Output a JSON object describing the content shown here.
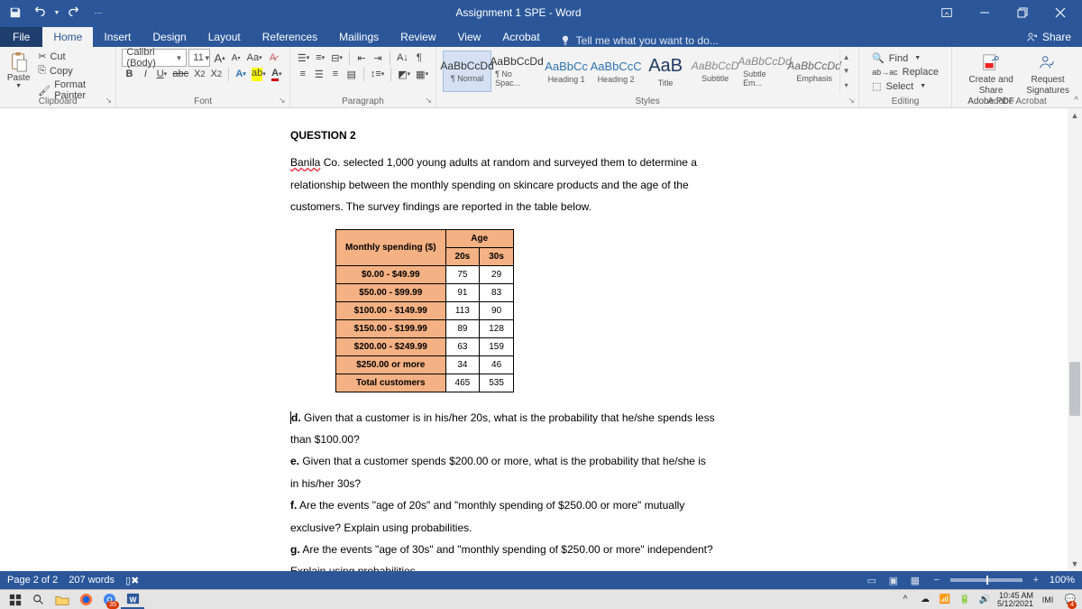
{
  "titlebar": {
    "title": "Assignment 1 SPE - Word"
  },
  "tabs": {
    "file": "File",
    "home": "Home",
    "insert": "Insert",
    "design": "Design",
    "layout": "Layout",
    "references": "References",
    "mailings": "Mailings",
    "review": "Review",
    "view": "View",
    "acrobat": "Acrobat",
    "tellme": "Tell me what you want to do...",
    "share": "Share"
  },
  "ribbon": {
    "clipboard": {
      "label": "Clipboard",
      "paste": "Paste",
      "cut": "Cut",
      "copy": "Copy",
      "painter": "Format Painter"
    },
    "font": {
      "label": "Font",
      "name": "Calibri (Body)",
      "size": "11"
    },
    "paragraph": {
      "label": "Paragraph"
    },
    "styles": {
      "label": "Styles",
      "items": [
        {
          "sample": "AaBbCcDd",
          "name": "¶ Normal",
          "cls": ""
        },
        {
          "sample": "AaBbCcDd",
          "name": "¶ No Spac...",
          "cls": ""
        },
        {
          "sample": "AaBbCc",
          "name": "Heading 1",
          "cls": "med"
        },
        {
          "sample": "AaBbCcC",
          "name": "Heading 2",
          "cls": "med"
        },
        {
          "sample": "AaB",
          "name": "Title",
          "cls": "bigger"
        },
        {
          "sample": "AaBbCcD",
          "name": "Subtitle",
          "cls": "subtle"
        },
        {
          "sample": "AaBbCcDd",
          "name": "Subtle Em...",
          "cls": "subtle"
        },
        {
          "sample": "AaBbCcDd",
          "name": "Emphasis",
          "cls": "emph"
        }
      ]
    },
    "editing": {
      "label": "Editing",
      "find": "Find",
      "replace": "Replace",
      "select": "Select"
    },
    "adobe": {
      "label": "Adobe Acrobat",
      "createShare": "Create and Share\nAdobe PDF",
      "request": "Request\nSignatures"
    }
  },
  "document": {
    "qhead": "QUESTION 2",
    "intro1a": "Banila",
    "intro1b": " Co. selected 1,000 young adults at random and surveyed them to determine a",
    "intro2": "relationship between the monthly spending on skincare products and the age of the",
    "intro3": "customers. The survey findings are reported in the table below.",
    "table": {
      "h1": "Monthly spending ($)",
      "h2": "Age",
      "h2a": "20s",
      "h2b": "30s",
      "rows": [
        {
          "label": "$0.00 - $49.99",
          "c20": "75",
          "c30": "29"
        },
        {
          "label": "$50.00 - $99.99",
          "c20": "91",
          "c30": "83"
        },
        {
          "label": "$100.00 - $149.99",
          "c20": "113",
          "c30": "90"
        },
        {
          "label": "$150.00 - $199.99",
          "c20": "89",
          "c30": "128"
        },
        {
          "label": "$200.00 - $249.99",
          "c20": "63",
          "c30": "159"
        },
        {
          "label": "$250.00 or more",
          "c20": "34",
          "c30": "46"
        },
        {
          "label": "Total customers",
          "c20": "465",
          "c30": "535"
        }
      ]
    },
    "qd1": "d. Given that a customer is in his/her 20s, what is the probability that he/she spends less",
    "qd2": "than $100.00?",
    "qe1": "e. Given that a customer spends $200.00 or more, what is the probability that he/she is",
    "qe2": "in his/her 30s?",
    "qf1": "f. Are the events \"age of 20s\" and \"monthly spending of $250.00 or more\" mutually",
    "qf2": "exclusive? Explain using probabilities.",
    "qg1": "g. Are the events \"age of 30s\" and \"monthly spending of $250.00 or more\" independent?",
    "qg2": "Explain using probabilities."
  },
  "statusbar": {
    "page": "Page 2 of 2",
    "words": "207 words",
    "zoom": "100%"
  },
  "taskbar": {
    "time": "10:45 AM",
    "date": "5/12/2021",
    "badge": "35",
    "badge2": "4"
  }
}
